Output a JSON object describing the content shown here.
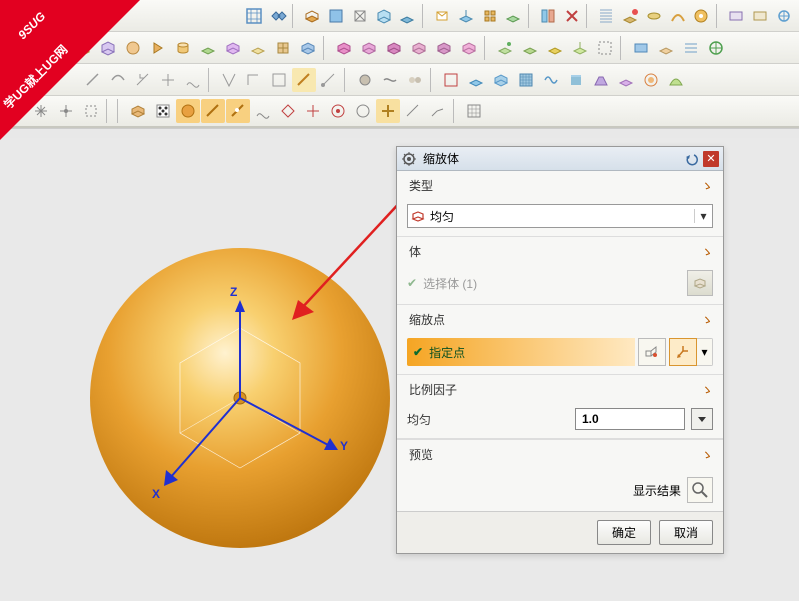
{
  "watermark": {
    "top": "9SUG",
    "line": "学UG就上UG网"
  },
  "dialog": {
    "title": "缩放体",
    "sections": {
      "type": {
        "header": "类型",
        "combo_label": "均匀"
      },
      "body": {
        "header": "体",
        "select_label": "选择体 (1)"
      },
      "scale_point": {
        "header": "缩放点",
        "specify_label": "指定点"
      },
      "scale_factor": {
        "header": "比例因子",
        "uniform_label": "均匀",
        "value": "1.0"
      },
      "preview": {
        "header": "预览",
        "show_result": "显示结果"
      }
    },
    "buttons": {
      "ok": "确定",
      "cancel": "取消"
    }
  },
  "axes": {
    "x": "X",
    "y": "Y",
    "z": "Z"
  }
}
